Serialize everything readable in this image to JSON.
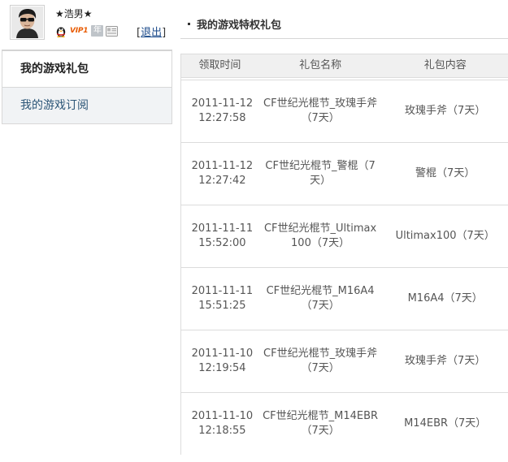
{
  "user": {
    "nickname": "★浩男★",
    "vip_label": "VIP1",
    "year_badge": "年",
    "logout_prefix": "[",
    "logout_label": "退出",
    "logout_suffix": "]"
  },
  "nav": {
    "items": [
      {
        "label": "我的游戏礼包",
        "active": true
      },
      {
        "label": "我的游戏订阅",
        "active": false
      }
    ]
  },
  "main": {
    "title": "我的游戏特权礼包",
    "table": {
      "headers": [
        "领取时间",
        "礼包名称",
        "礼包内容"
      ],
      "rows": [
        {
          "date": "2011-11-12",
          "time": "12:27:58",
          "name": "CF世纪光棍节_玫瑰手斧（7天）",
          "content": "玫瑰手斧（7天）"
        },
        {
          "date": "2011-11-12",
          "time": "12:27:42",
          "name": "CF世纪光棍节_警棍（7天）",
          "content": "警棍（7天）"
        },
        {
          "date": "2011-11-11",
          "time": "15:52:00",
          "name": "CF世纪光棍节_Ultimax100（7天）",
          "content": "Ultimax100（7天）"
        },
        {
          "date": "2011-11-11",
          "time": "15:51:25",
          "name": "CF世纪光棍节_M16A4（7天）",
          "content": "M16A4（7天）"
        },
        {
          "date": "2011-11-10",
          "time": "12:19:54",
          "name": "CF世纪光棍节_玫瑰手斧（7天）",
          "content": "玫瑰手斧（7天）"
        },
        {
          "date": "2011-11-10",
          "time": "12:18:55",
          "name": "CF世纪光棍节_M14EBR（7天）",
          "content": "M14EBR（7天）"
        }
      ]
    }
  },
  "colors": {
    "link": "#1a4a8a",
    "vip": "#e85a00",
    "nav_inactive_bg": "#f1f3f5",
    "table_header_bg": "#f0f0f0"
  },
  "icons": [
    "avatar",
    "qq-penguin-icon",
    "card-icon"
  ]
}
